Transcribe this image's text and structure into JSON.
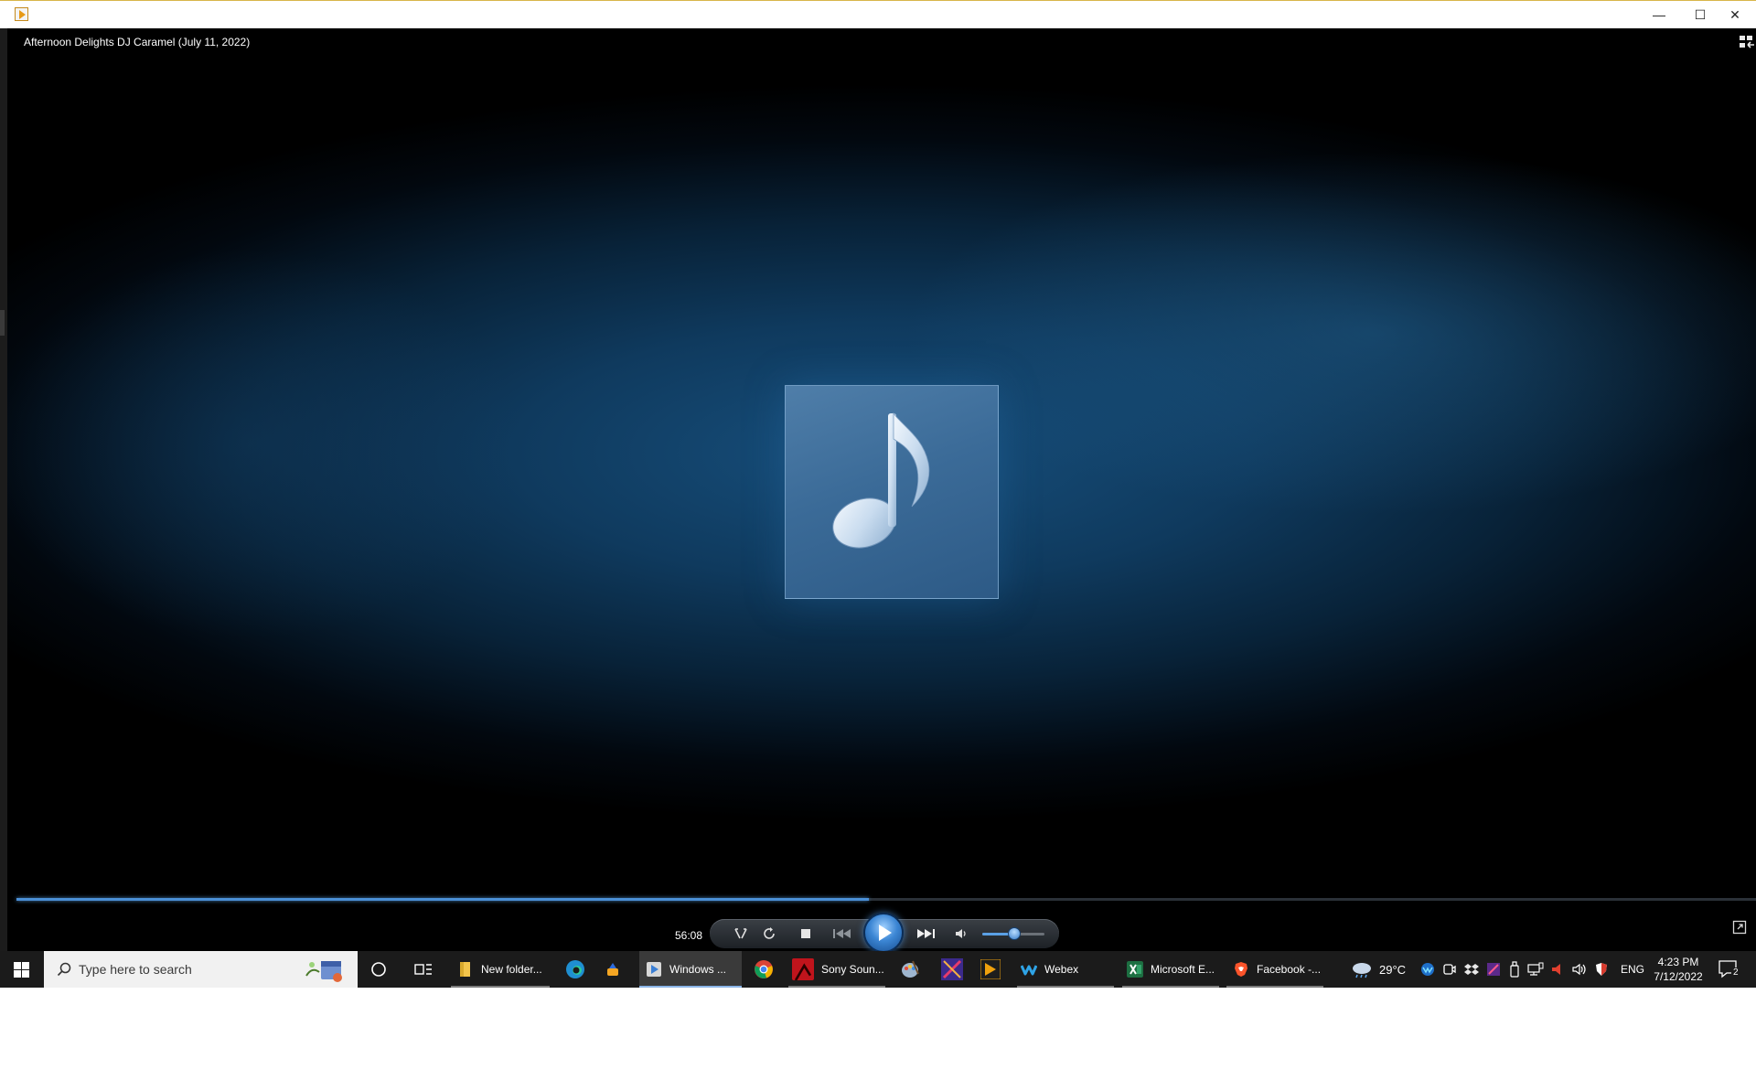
{
  "window": {
    "controls": {
      "minimize": "—",
      "maximize": "☐",
      "close": "✕"
    }
  },
  "player": {
    "track_title": "Afternoon Delights DJ Caramel (July 11, 2022)",
    "elapsed": "56:08",
    "progress_fraction": 0.49,
    "volume_fraction": 0.52,
    "accent_color": "#4b8fd6",
    "art_icon": "music-note-icon"
  },
  "taskbar": {
    "search_placeholder": "Type here to search",
    "apps": [
      {
        "label": "New folder..."
      },
      {
        "label": "Windows ..."
      },
      {
        "label": "Sony Soun..."
      },
      {
        "label": "Webex"
      },
      {
        "label": "Microsoft E..."
      },
      {
        "label": "Facebook -..."
      }
    ],
    "weather": "29°C",
    "language": "ENG",
    "time": "4:23 PM",
    "date": "7/12/2022",
    "notification_count": "2"
  }
}
